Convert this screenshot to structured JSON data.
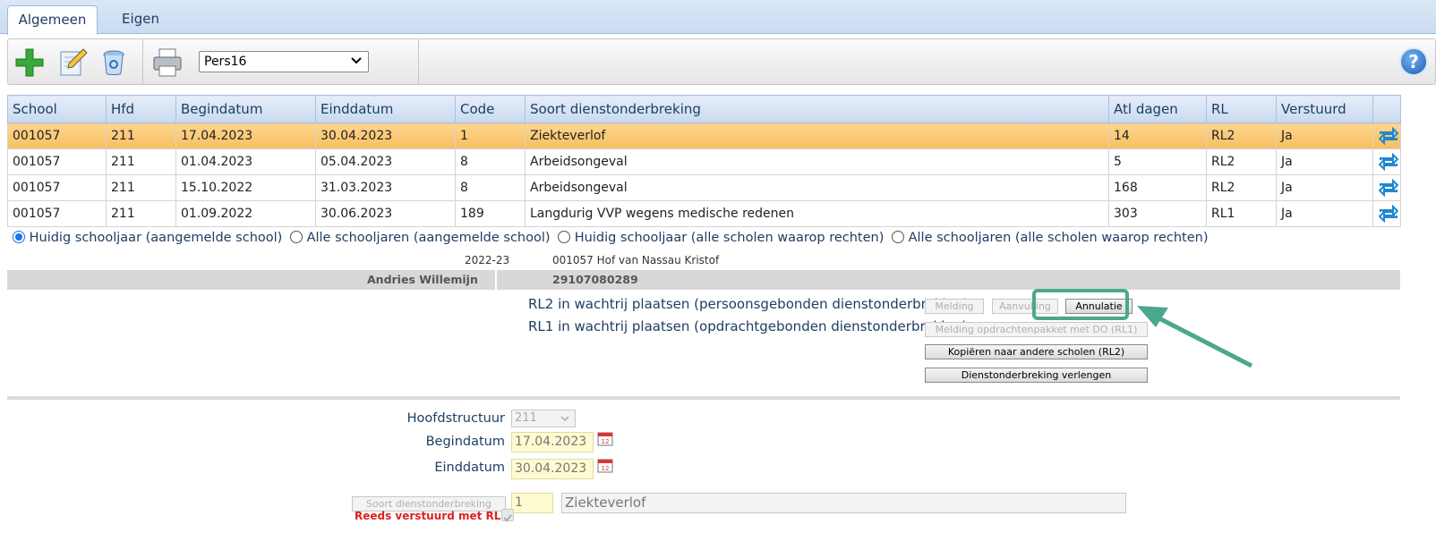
{
  "tabs": [
    "Algemeen",
    "Eigen"
  ],
  "toolbar": {
    "icons": [
      "add-icon",
      "edit-icon",
      "delete-icon",
      "print-icon",
      "help-icon"
    ],
    "pers_select": "Pers16"
  },
  "grid": {
    "headers": [
      "School",
      "Hfd",
      "Begindatum",
      "Einddatum",
      "Code",
      "Soort dienstonderbreking",
      "Atl dagen",
      "RL",
      "Verstuurd"
    ],
    "rows": [
      {
        "school": "001057",
        "hfd": "211",
        "begin": "17.04.2023",
        "eind": "30.04.2023",
        "code": "1",
        "soort": "Ziekteverlof",
        "atl": "14",
        "rl": "RL2",
        "verstuurd": "Ja"
      },
      {
        "school": "001057",
        "hfd": "211",
        "begin": "01.04.2023",
        "eind": "05.04.2023",
        "code": "8",
        "soort": "Arbeidsongeval",
        "atl": "5",
        "rl": "RL2",
        "verstuurd": "Ja"
      },
      {
        "school": "001057",
        "hfd": "211",
        "begin": "15.10.2022",
        "eind": "31.03.2023",
        "code": "8",
        "soort": "Arbeidsongeval",
        "atl": "168",
        "rl": "RL2",
        "verstuurd": "Ja"
      },
      {
        "school": "001057",
        "hfd": "211",
        "begin": "01.09.2022",
        "eind": "30.06.2023",
        "code": "189",
        "soort": "Langdurig VVP wegens medische redenen",
        "atl": "303",
        "rl": "RL1",
        "verstuurd": "Ja"
      }
    ]
  },
  "filters": [
    "Huidig schooljaar (aangemelde school)",
    "Alle schooljaren (aangemelde school)",
    "Huidig schooljaar (alle scholen waarop rechten)",
    "Alle schooljaren (alle scholen waarop rechten)"
  ],
  "info": {
    "schooljaar": "2022-23",
    "school": "001057 Hof van Nassau Kristof",
    "person": "Andries Willemijn",
    "number": "29107080289"
  },
  "actions": {
    "rl2_label": "RL2 in wachtrij plaatsen (persoonsgebonden dienstonderbreking)",
    "rl1_label": "RL1 in wachtrij plaatsen (opdrachtgebonden dienstonderbreking)",
    "melding": "Melding",
    "aanvulling": "Aanvulling",
    "annulatie": "Annulatie",
    "melding_rl1": "Melding opdrachtenpakket met DO (RL1)",
    "kopieren": "Kopiëren naar andere scholen (RL2)",
    "verlengen": "Dienstonderbreking verlengen"
  },
  "form": {
    "hoofdstructuur_label": "Hoofdstructuur",
    "hoofdstructuur_value": "211",
    "begindatum_label": "Begindatum",
    "begindatum_value": "17.04.2023",
    "einddatum_label": "Einddatum",
    "einddatum_value": "30.04.2023",
    "soort_button": "Soort dienstonderbreking",
    "soort_code": "1",
    "soort_desc": "Ziekteverlof",
    "reeds_label": "Reeds verstuurd met RL2"
  },
  "colors": {
    "accent": "#1f3d63",
    "selected_row": "#f6bf60",
    "highlight": "#4aa88f",
    "warning": "#e02020"
  }
}
